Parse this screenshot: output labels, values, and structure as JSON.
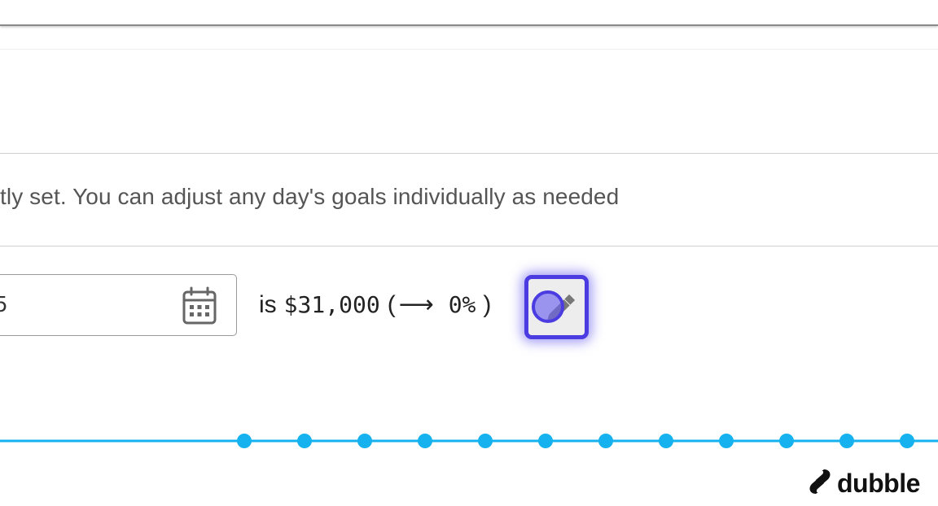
{
  "info": {
    "text": "tly set. You can adjust any day's goals individually as needed"
  },
  "date_field": {
    "value": "5"
  },
  "goal": {
    "prefix": "is ",
    "amount": "$31,000",
    "open_paren": "(",
    "arrow": "⟶",
    "change": "0%",
    "close_paren": ")"
  },
  "icons": {
    "calendar": "calendar-icon",
    "edit": "pencil-icon",
    "logo": "dubble-logo-icon"
  },
  "timeline": {
    "points": 12
  },
  "logo": {
    "text": "dubble"
  },
  "colors": {
    "accent": "#4a3ce0",
    "timeline": "#15b2ef",
    "text": "#555555"
  }
}
